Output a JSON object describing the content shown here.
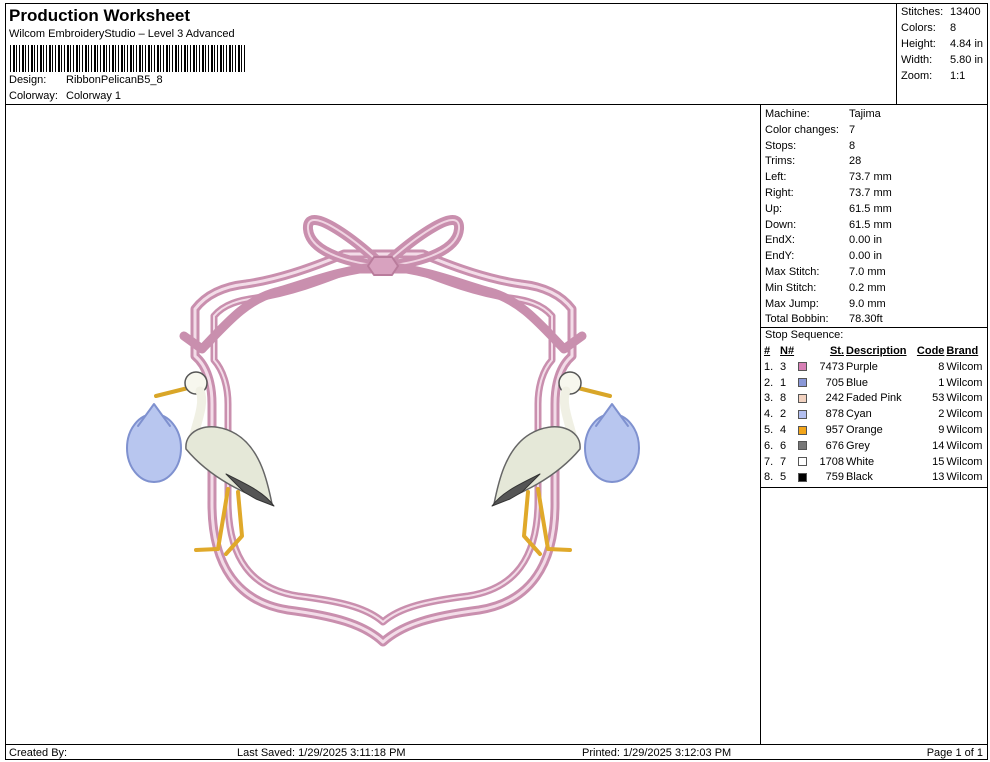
{
  "header": {
    "title": "Production Worksheet",
    "subtitle": "Wilcom EmbroideryStudio – Level 3 Advanced",
    "design_label": "Design:",
    "design_value": "RibbonPelicanB5_8",
    "colorway_label": "Colorway:",
    "colorway_value": "Colorway 1"
  },
  "stats": [
    {
      "label": "Stitches:",
      "value": "13400"
    },
    {
      "label": "Colors:",
      "value": "8"
    },
    {
      "label": "Height:",
      "value": "4.84 in"
    },
    {
      "label": "Width:",
      "value": "5.80 in"
    },
    {
      "label": "Zoom:",
      "value": "1:1"
    }
  ],
  "machine_info": [
    {
      "label": "Machine:",
      "value": "Tajima"
    },
    {
      "label": "Color changes:",
      "value": "7"
    },
    {
      "label": "Stops:",
      "value": "8"
    },
    {
      "label": "Trims:",
      "value": "28"
    },
    {
      "label": "Left:",
      "value": "73.7 mm"
    },
    {
      "label": "Right:",
      "value": "73.7 mm"
    },
    {
      "label": "Up:",
      "value": "61.5 mm"
    },
    {
      "label": "Down:",
      "value": "61.5 mm"
    },
    {
      "label": "EndX:",
      "value": "0.00 in"
    },
    {
      "label": "EndY:",
      "value": "0.00 in"
    },
    {
      "label": "Max Stitch:",
      "value": "7.0 mm"
    },
    {
      "label": "Min Stitch:",
      "value": "0.2 mm"
    },
    {
      "label": "Max Jump:",
      "value": "9.0 mm"
    },
    {
      "label": "Total Bobbin:",
      "value": "78.30ft"
    }
  ],
  "stop_sequence": {
    "title": "Stop Sequence:",
    "headers": {
      "num": "#",
      "n": "N#",
      "st": "St.",
      "description": "Description",
      "code": "Code",
      "brand": "Brand"
    },
    "rows": [
      {
        "num": "1.",
        "n": "3",
        "color": "#d77fb5",
        "st": "7473",
        "description": "Purple",
        "code": "8",
        "brand": "Wilcom"
      },
      {
        "num": "2.",
        "n": "1",
        "color": "#8a98d8",
        "st": "705",
        "description": "Blue",
        "code": "1",
        "brand": "Wilcom"
      },
      {
        "num": "3.",
        "n": "8",
        "color": "#f2d2c0",
        "st": "242",
        "description": "Faded Pink",
        "code": "53",
        "brand": "Wilcom"
      },
      {
        "num": "4.",
        "n": "2",
        "color": "#b3bff0",
        "st": "878",
        "description": "Cyan",
        "code": "2",
        "brand": "Wilcom"
      },
      {
        "num": "5.",
        "n": "4",
        "color": "#f2a51a",
        "st": "957",
        "description": "Orange",
        "code": "9",
        "brand": "Wilcom"
      },
      {
        "num": "6.",
        "n": "6",
        "color": "#777777",
        "st": "676",
        "description": "Grey",
        "code": "14",
        "brand": "Wilcom"
      },
      {
        "num": "7.",
        "n": "7",
        "color": "#ffffff",
        "st": "1708",
        "description": "White",
        "code": "15",
        "brand": "Wilcom"
      },
      {
        "num": "8.",
        "n": "5",
        "color": "#000000",
        "st": "759",
        "description": "Black",
        "code": "13",
        "brand": "Wilcom"
      }
    ]
  },
  "footer": {
    "created_by": "Created By:",
    "last_saved": "Last Saved: 1/29/2025 3:11:18 PM",
    "printed": "Printed: 1/29/2025 3:12:03 PM",
    "page": "Page 1 of 1"
  }
}
